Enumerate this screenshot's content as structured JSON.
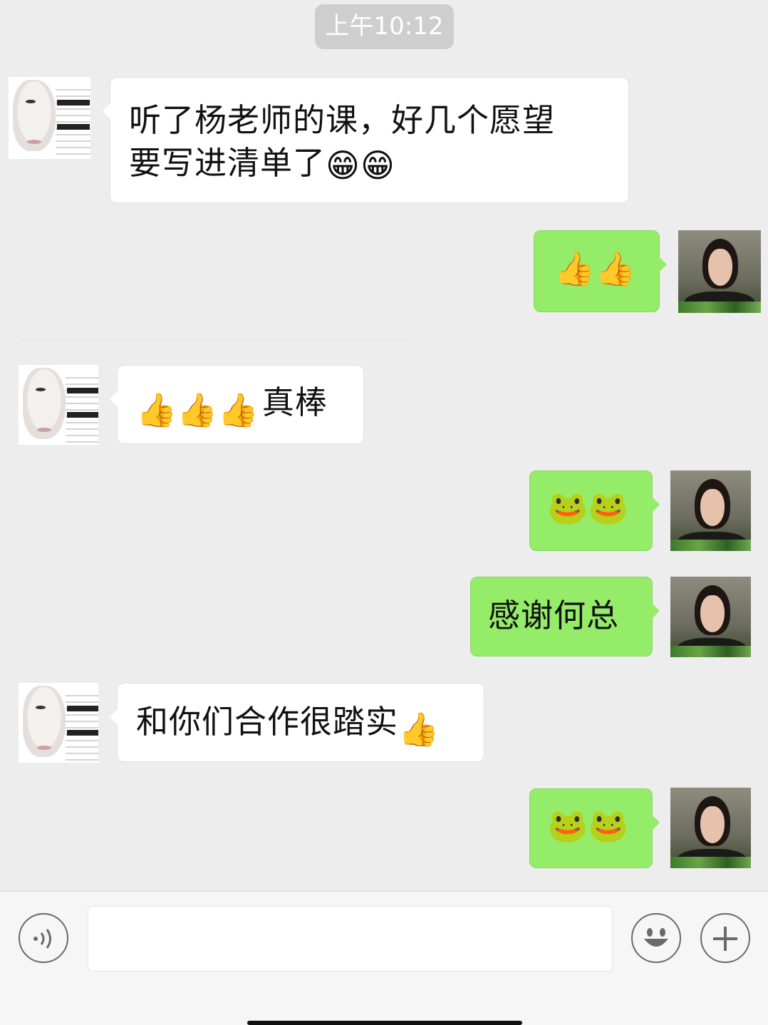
{
  "timestamp": "上午10:12",
  "messages": [
    {
      "from": "them",
      "text": "听了杨老师的课，好几个愿望",
      "text2": "要写进清单了",
      "emoji": "😁😁"
    },
    {
      "from": "me",
      "emoji": "👍👍"
    },
    {
      "from": "them",
      "emoji": "👍👍👍",
      "text": "真棒"
    },
    {
      "from": "me",
      "emoji": "🐸🐸"
    },
    {
      "from": "me",
      "text": "感谢何总"
    },
    {
      "from": "them",
      "text": "和你们合作很踏实",
      "emoji": "👍"
    },
    {
      "from": "me",
      "emoji": "🐸🐸"
    }
  ],
  "colors": {
    "background": "#ededed",
    "incoming_bubble": "#ffffff",
    "outgoing_bubble": "#95ec69"
  },
  "composer": {
    "voice_icon": "voice-icon",
    "emoji_icon": "emoji-face-icon",
    "plus_icon": "plus-icon",
    "input_value": ""
  }
}
